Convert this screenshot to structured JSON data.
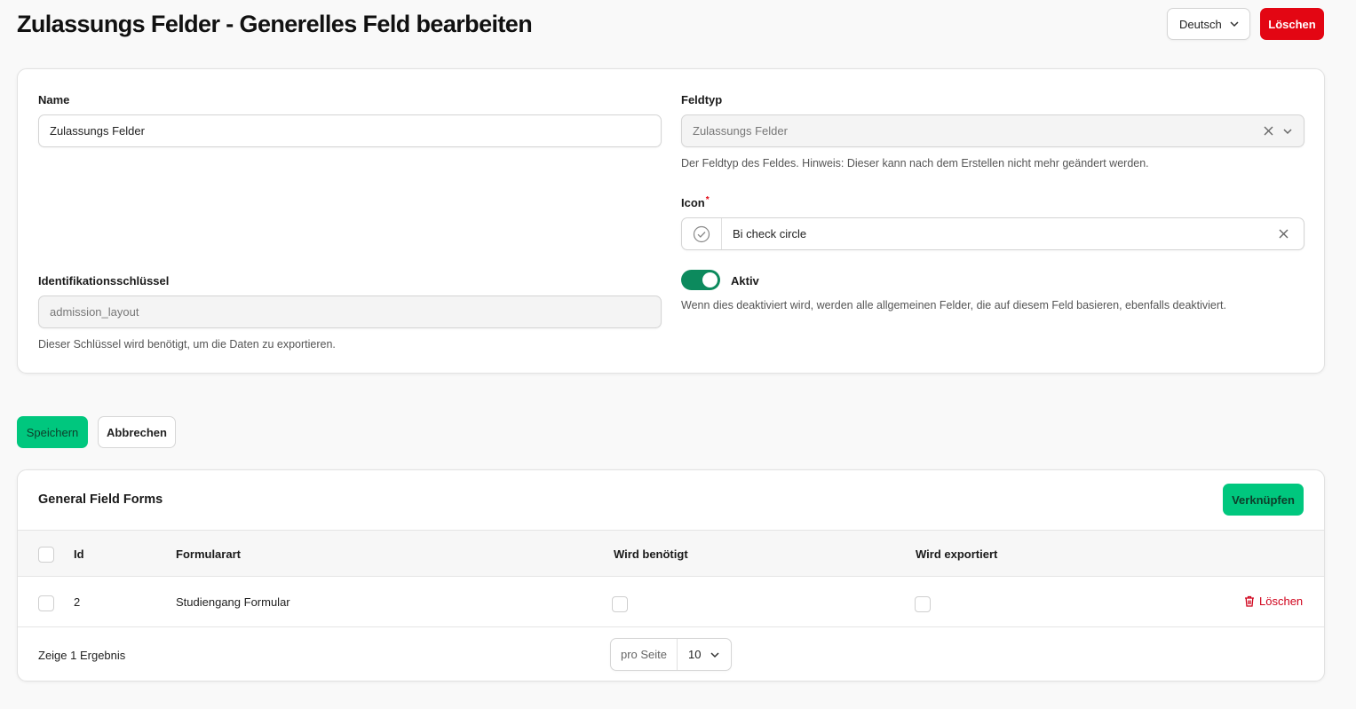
{
  "header": {
    "title": "Zulassungs Felder - Generelles Feld bearbeiten",
    "language": "Deutsch",
    "delete_label": "Löschen"
  },
  "form": {
    "name": {
      "label": "Name",
      "value": "Zulassungs Felder"
    },
    "identifier": {
      "label": "Identifikationsschlüssel",
      "value": "admission_layout",
      "hint": "Dieser Schlüssel wird benötigt, um die Daten zu exportieren."
    },
    "field_type": {
      "label": "Feldtyp",
      "value": "Zulassungs Felder",
      "hint": "Der Feldtyp des Feldes. Hinweis: Dieser kann nach dem Erstellen nicht mehr geändert werden."
    },
    "icon": {
      "label": "Icon",
      "required_mark": "*",
      "value": "Bi check circle",
      "icon_name": "check-circle-icon"
    },
    "active": {
      "label": "Aktiv",
      "checked": true,
      "hint": "Wenn dies deaktiviert wird, werden alle allgemeinen Felder, die auf diesem Feld basieren, ebenfalls deaktiviert."
    }
  },
  "actions": {
    "save_label": "Speichern",
    "cancel_label": "Abbrechen"
  },
  "table": {
    "title": "General Field Forms",
    "link_label": "Verknüpfen",
    "columns": [
      "Id",
      "Formularart",
      "Wird benötigt",
      "Wird exportiert"
    ],
    "rows": [
      {
        "id": "2",
        "form_type": "Studiengang Formular",
        "required": false,
        "exported": false,
        "delete_label": "Löschen"
      }
    ],
    "footer": {
      "result_text": "Zeige 1 Ergebnis",
      "per_page_label": "pro Seite",
      "per_page_value": "10"
    }
  },
  "colors": {
    "primary": "#00c77e",
    "danger": "#e30613",
    "toggle": "#0c8a5d"
  }
}
